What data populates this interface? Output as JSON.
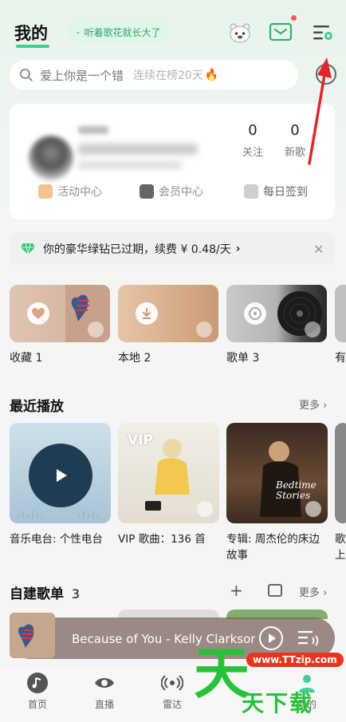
{
  "header": {
    "title": "我的",
    "chip_label": "听着歌花就长大了"
  },
  "search": {
    "placeholder": "爱上你是一个错",
    "trend_text": "连续在榜20天"
  },
  "profile": {
    "follow_count": "0",
    "follow_label": "关注",
    "new_songs_count": "0",
    "new_songs_label": "新歌",
    "activity_center": "活动中心",
    "member_center": "会员中心",
    "daily_checkin": "每日签到"
  },
  "vip_banner": {
    "text": "你的豪华绿钻已过期，续费 ¥ 0.48/天"
  },
  "quick_tiles": [
    {
      "label": "收藏 1"
    },
    {
      "label": "本地 2"
    },
    {
      "label": "歌单 3"
    },
    {
      "label": "有"
    }
  ],
  "recent": {
    "title": "最近播放",
    "more": "更多",
    "items": [
      {
        "label": "音乐电台: 个性电台"
      },
      {
        "label": "VIP 歌曲：136 首"
      },
      {
        "label": "专辑: 周杰伦的床边故事"
      },
      {
        "label": "歌上"
      }
    ],
    "vip_badge": "VIP",
    "album_art_text": "Bedtime Stories"
  },
  "playlists": {
    "title": "自建歌单",
    "count": "3",
    "more": "更多"
  },
  "player": {
    "now_playing": "Because of You - Kelly Clarkson"
  },
  "nav": [
    {
      "label": "首页"
    },
    {
      "label": "直播"
    },
    {
      "label": "雷达"
    },
    {
      "label": "我的"
    }
  ],
  "watermark": {
    "big": "天",
    "small": "天下载",
    "url": "www.TTzip.com"
  },
  "colors": {
    "accent_green": "#3fcf8e",
    "arrow_red": "#e0262a",
    "notification_dot": "#ff5a5a"
  }
}
